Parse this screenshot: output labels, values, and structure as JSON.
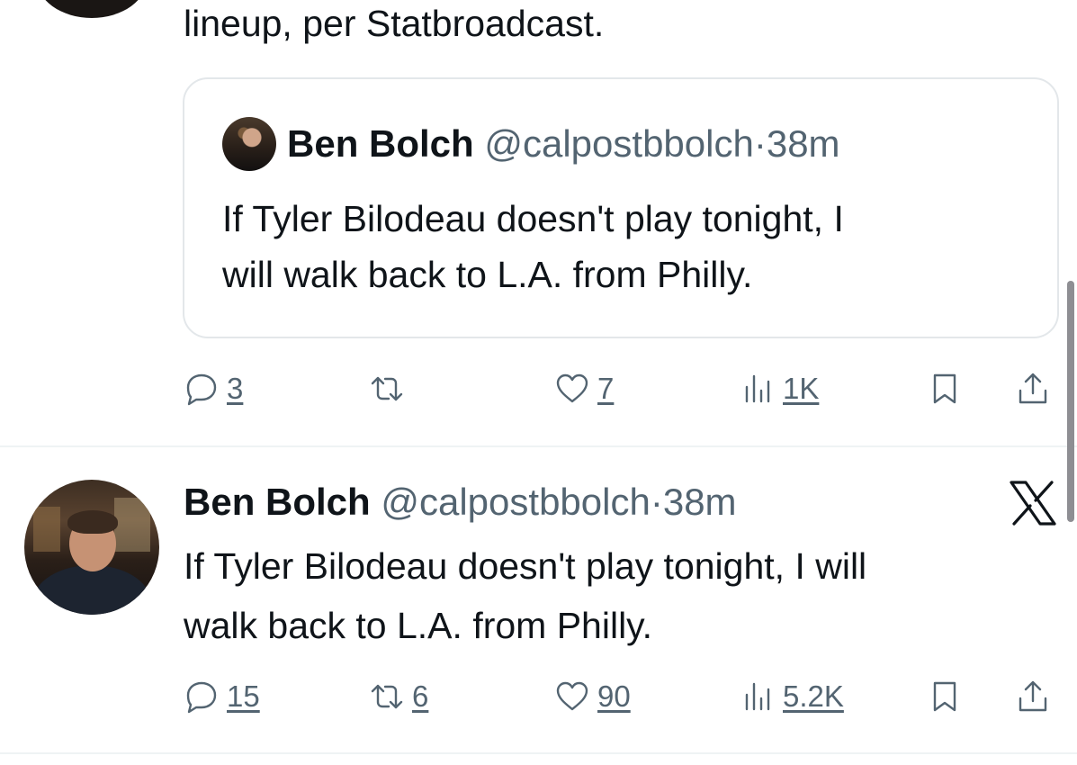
{
  "previous_tweet": {
    "text_tail": "lineup, per Statbroadcast."
  },
  "quoted_tweet": {
    "name": "Ben Bolch",
    "handle": "@calpostbbolch",
    "separator": "·",
    "time": "38m",
    "line1": "If Tyler Bilodeau doesn't play tonight, I",
    "line2": "will walk back to L.A. from Philly."
  },
  "previous_actions": {
    "replies": "3",
    "reposts": "",
    "likes": "7",
    "views": "1K"
  },
  "tweet": {
    "name": "Ben Bolch",
    "handle": "@calpostbbolch",
    "separator": "·",
    "time": "38m",
    "line1": "If Tyler Bilodeau doesn't play tonight, I will",
    "line2": "walk back to L.A. from Philly."
  },
  "tweet_actions": {
    "replies": "15",
    "reposts": "6",
    "likes": "90",
    "views": "5.2K"
  },
  "icons": [
    "reply-icon",
    "repost-icon",
    "like-icon",
    "views-icon",
    "bookmark-icon",
    "share-icon",
    "x-logo-icon"
  ],
  "colors": {
    "text": "#0f1419",
    "secondary": "#536471",
    "border": "#e3e7ea"
  }
}
